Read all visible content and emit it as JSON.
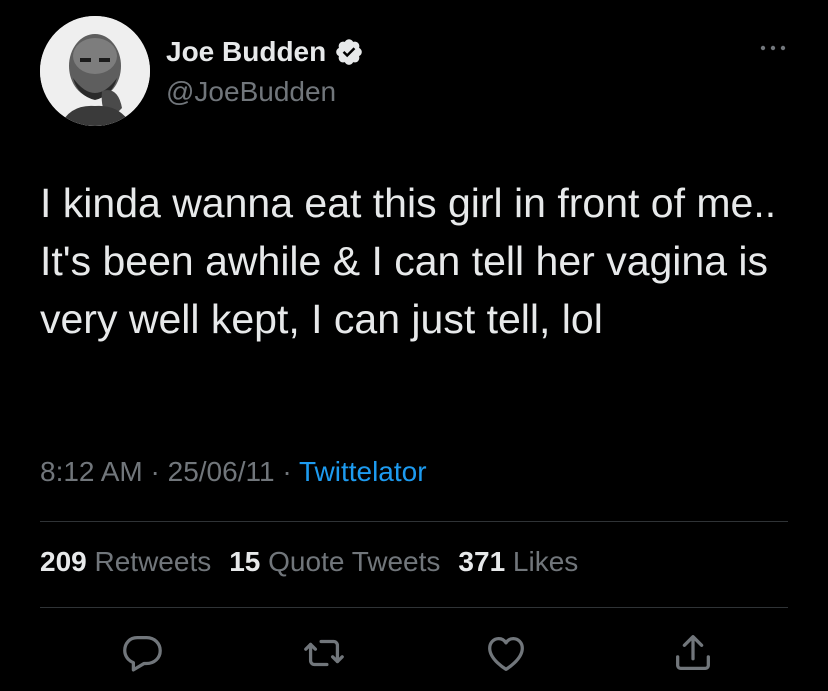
{
  "author": {
    "name": "Joe Budden",
    "handle": "@JoeBudden",
    "verified": true
  },
  "tweet": {
    "text": "I kinda wanna eat this girl in front of me.. It's been awhile & I can tell her vagina is very well kept, I can just tell, lol",
    "time": "8:12 AM",
    "date": "25/06/11",
    "separator": "·",
    "source": "Twittelator"
  },
  "stats": {
    "retweets_count": "209",
    "retweets_label": "Retweets",
    "quotes_count": "15",
    "quotes_label": "Quote Tweets",
    "likes_count": "371",
    "likes_label": "Likes"
  },
  "icons": {
    "more": "more-icon",
    "verified": "verified-badge-icon",
    "reply": "reply-icon",
    "retweet": "retweet-icon",
    "like": "like-icon",
    "share": "share-icon"
  },
  "colors": {
    "background": "#000000",
    "text": "#e7e9ea",
    "secondary": "#71767b",
    "accent": "#1d9bf0",
    "divider": "#2f3336"
  }
}
